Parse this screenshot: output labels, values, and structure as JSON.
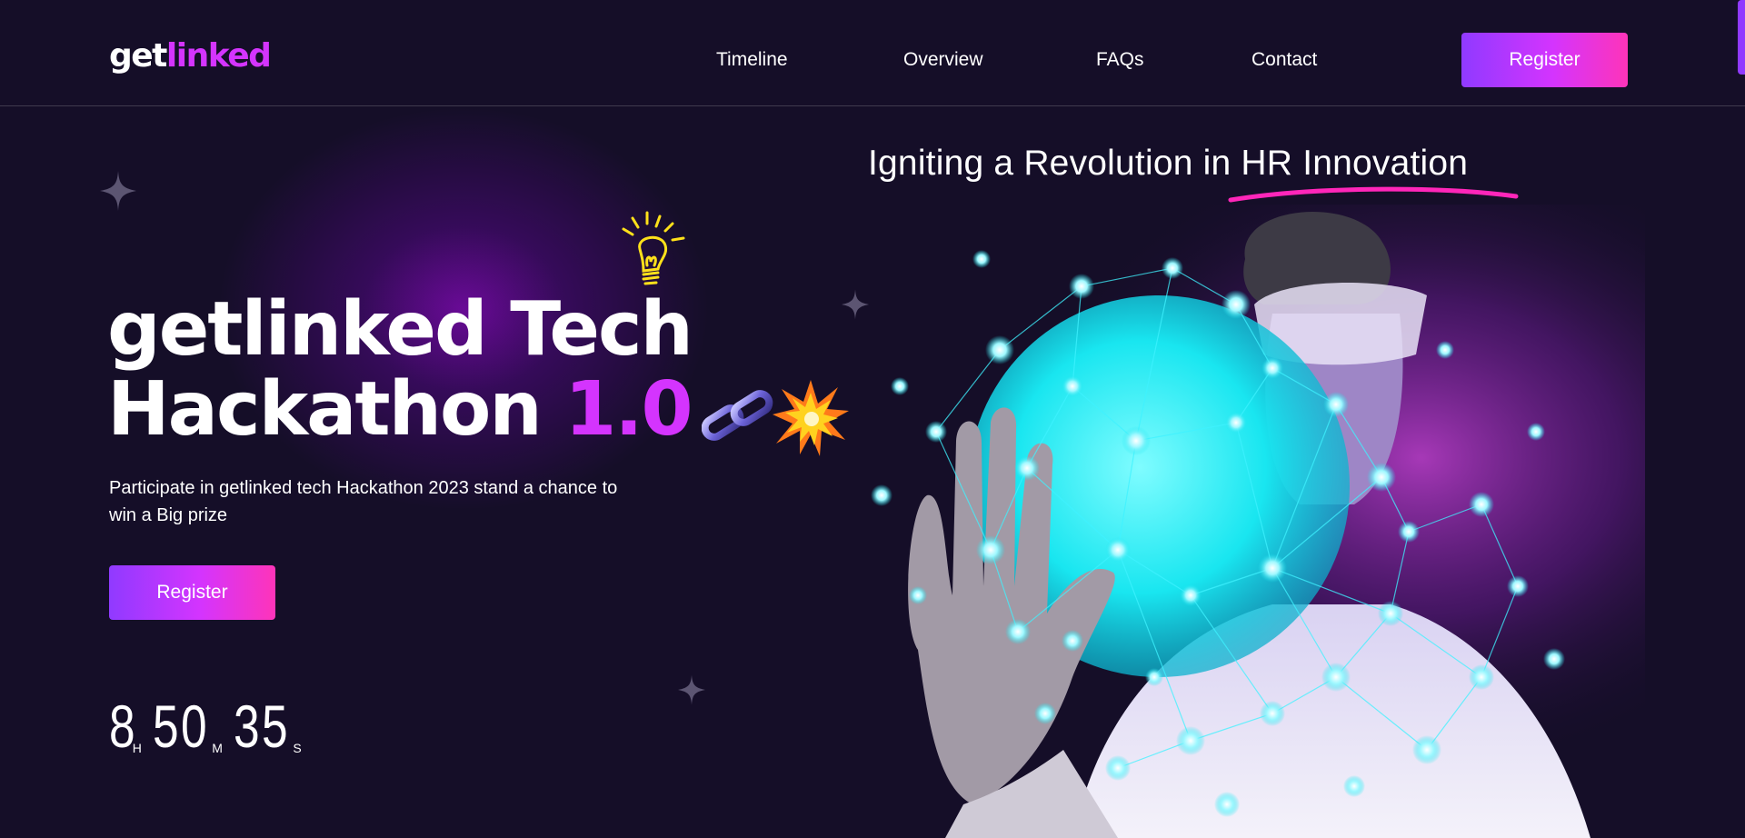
{
  "header": {
    "logo": {
      "part1": "get",
      "part2": "linked"
    },
    "nav": [
      {
        "label": "Timeline"
      },
      {
        "label": "Overview"
      },
      {
        "label": "FAQs"
      },
      {
        "label": "Contact"
      }
    ],
    "register_label": "Register"
  },
  "hero": {
    "tagline": "Igniting a Revolution in HR Innovation",
    "title_line1": "getlinked Tech",
    "title_line2_main": "Hackathon",
    "title_line2_accent": "1.0",
    "description": "Participate in getlinked tech Hackathon 2023 stand a chance to win a Big prize",
    "register_label": "Register",
    "countdown": {
      "hours": "8",
      "hours_unit": "H",
      "minutes": "50",
      "minutes_unit": "M",
      "seconds": "35",
      "seconds_unit": "S"
    }
  },
  "icons": {
    "bulb": "light-bulb-icon",
    "chain": "chain-link-icon",
    "burst": "collision-burst-icon",
    "sparkle": "star-sparkle-icon"
  },
  "colors": {
    "background": "#150e28",
    "accent_purple": "#d434fe",
    "gradient_start": "#903aff",
    "gradient_end": "#fe34b9",
    "underline": "#ff26b9",
    "bulb": "#ffe11a"
  }
}
